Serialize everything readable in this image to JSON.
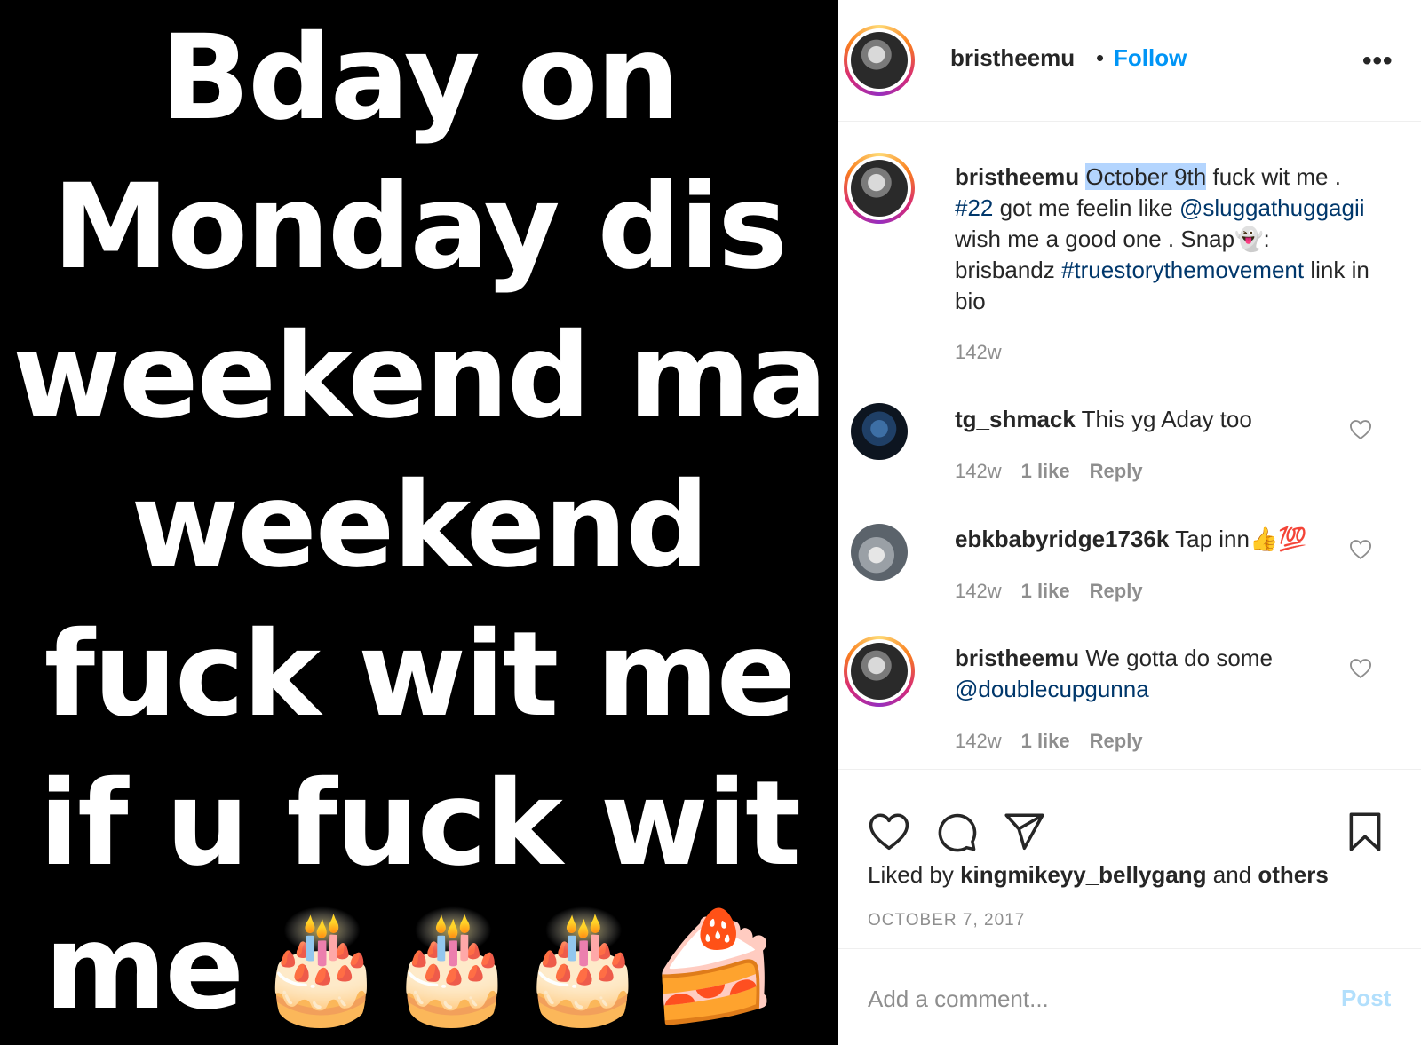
{
  "post_image": {
    "lines": [
      "Bday on",
      "Monday dis",
      "weekend ma",
      "weekend",
      "fuck wit me",
      "if u fuck wit"
    ],
    "last_line": "me",
    "emojis": "🎂🎂🎂🍰"
  },
  "header": {
    "username": "bristheemu",
    "separator": "•",
    "follow_label": "Follow",
    "more_label": "•••"
  },
  "caption": {
    "username": "bristheemu",
    "highlight": "October 9th",
    "text_1": " fuck wit me .",
    "hashtag_1": "#22",
    "text_2": " got me feelin like",
    "mention_1": "@sluggathuggagii",
    "text_3": " wish me a good one . Snap👻: brisbandz",
    "hashtag_2": "#truestorythemovement",
    "text_4": " link in bio",
    "age": "142w"
  },
  "comments": [
    {
      "username": "tg_shmack",
      "text": " This yg Aday too",
      "age": "142w",
      "likes": "1 like",
      "reply": "Reply"
    },
    {
      "username": "ebkbabyridge1736k",
      "text": " Tap inn👍💯",
      "age": "142w",
      "likes": "1 like",
      "reply": "Reply"
    },
    {
      "username": "bristheemu",
      "text": " We gotta do some ",
      "mention": "@doublecupgunna",
      "age": "142w",
      "likes": "1 like",
      "reply": "Reply"
    }
  ],
  "likes_line": {
    "prefix": "Liked by ",
    "user": "kingmikeyy_bellygang",
    "middle": " and ",
    "others": "others"
  },
  "date": "OCTOBER 7, 2017",
  "comment_box": {
    "placeholder": "Add a comment...",
    "post_label": "Post"
  },
  "colors": {
    "follow_blue": "#0095f6",
    "post_disabled": "#b2dffc",
    "link": "#00376b",
    "muted": "#8e8e8e",
    "highlight": "#b4d5fe"
  }
}
